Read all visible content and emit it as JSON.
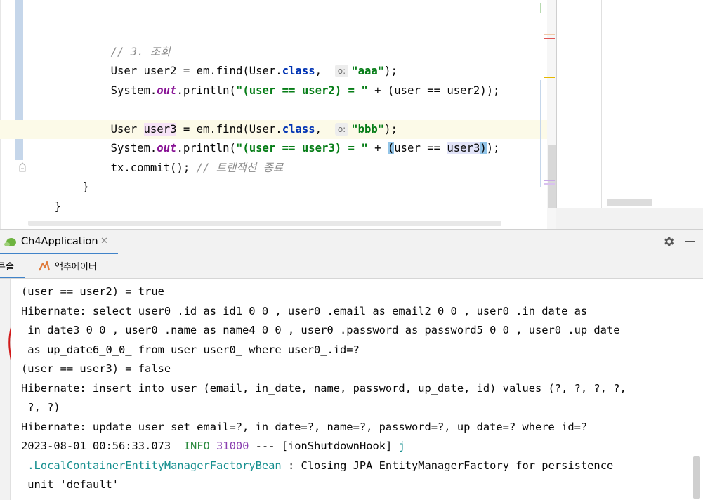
{
  "editor": {
    "lines": [
      {
        "comment": "// 3. 조회"
      },
      {
        "pre": "User user2 = em.find(User.",
        "kw": "class",
        "post": ",",
        "hint": "o:",
        "str": "\"aaa\"",
        "end": ");"
      },
      {
        "pre": "System.",
        "fld": "out",
        "mid": ".println(",
        "str": "\"(user == user2) = \"",
        "end": " + (user == user2));"
      },
      {
        "a": "User ",
        "var": "user3",
        "b": " = em.find(User.",
        "kw": "class",
        "post": ",",
        "hint": "o:",
        "str": "\"bbb\"",
        "end": ");"
      },
      {
        "pre": "System.",
        "fld": "out",
        "mid": ".println(",
        "str": "\"(user == user3) = \"",
        "a": " + ",
        "p1": "(",
        "b": "user == ",
        "id": "user3",
        "p2": ")",
        "end": ");"
      },
      {
        "pre": "tx.commit(); ",
        "comment": "// 트랜잭션 종료"
      },
      {
        "text": "}"
      },
      {
        "text": "}"
      }
    ]
  },
  "run": {
    "tab_label": "Ch4Application",
    "console_tab": "콘솔",
    "actuator_tab": "액추에이터"
  },
  "console": {
    "lines": [
      "(user == user2) = true",
      "Hibernate: select user0_.id as id1_0_0_, user0_.email as email2_0_0_, user0_.in_date as",
      " in_date3_0_0_, user0_.name as name4_0_0_, user0_.password as password5_0_0_, user0_.up_date",
      " as up_date6_0_0_ from user user0_ where user0_.id=?",
      "(user == user3) = false",
      "Hibernate: insert into user (email, in_date, name, password, up_date, id) values (?, ?, ?, ?,",
      " ?, ?)",
      "Hibernate: update user set email=?, in_date=?, name=?, password=?, up_date=? where id=?"
    ],
    "log": {
      "timestamp": "2023-08-01 00:56:33.073",
      "level": "INFO",
      "pid": "31000",
      "sep": "---",
      "thread": "[ionShutdownHook]",
      "logger_head": "j",
      "logger_tail": ".LocalContainerEntityManagerFactoryBean",
      "message": ": Closing JPA EntityManagerFactory for persistence",
      "message_cont": "unit 'default'"
    }
  }
}
